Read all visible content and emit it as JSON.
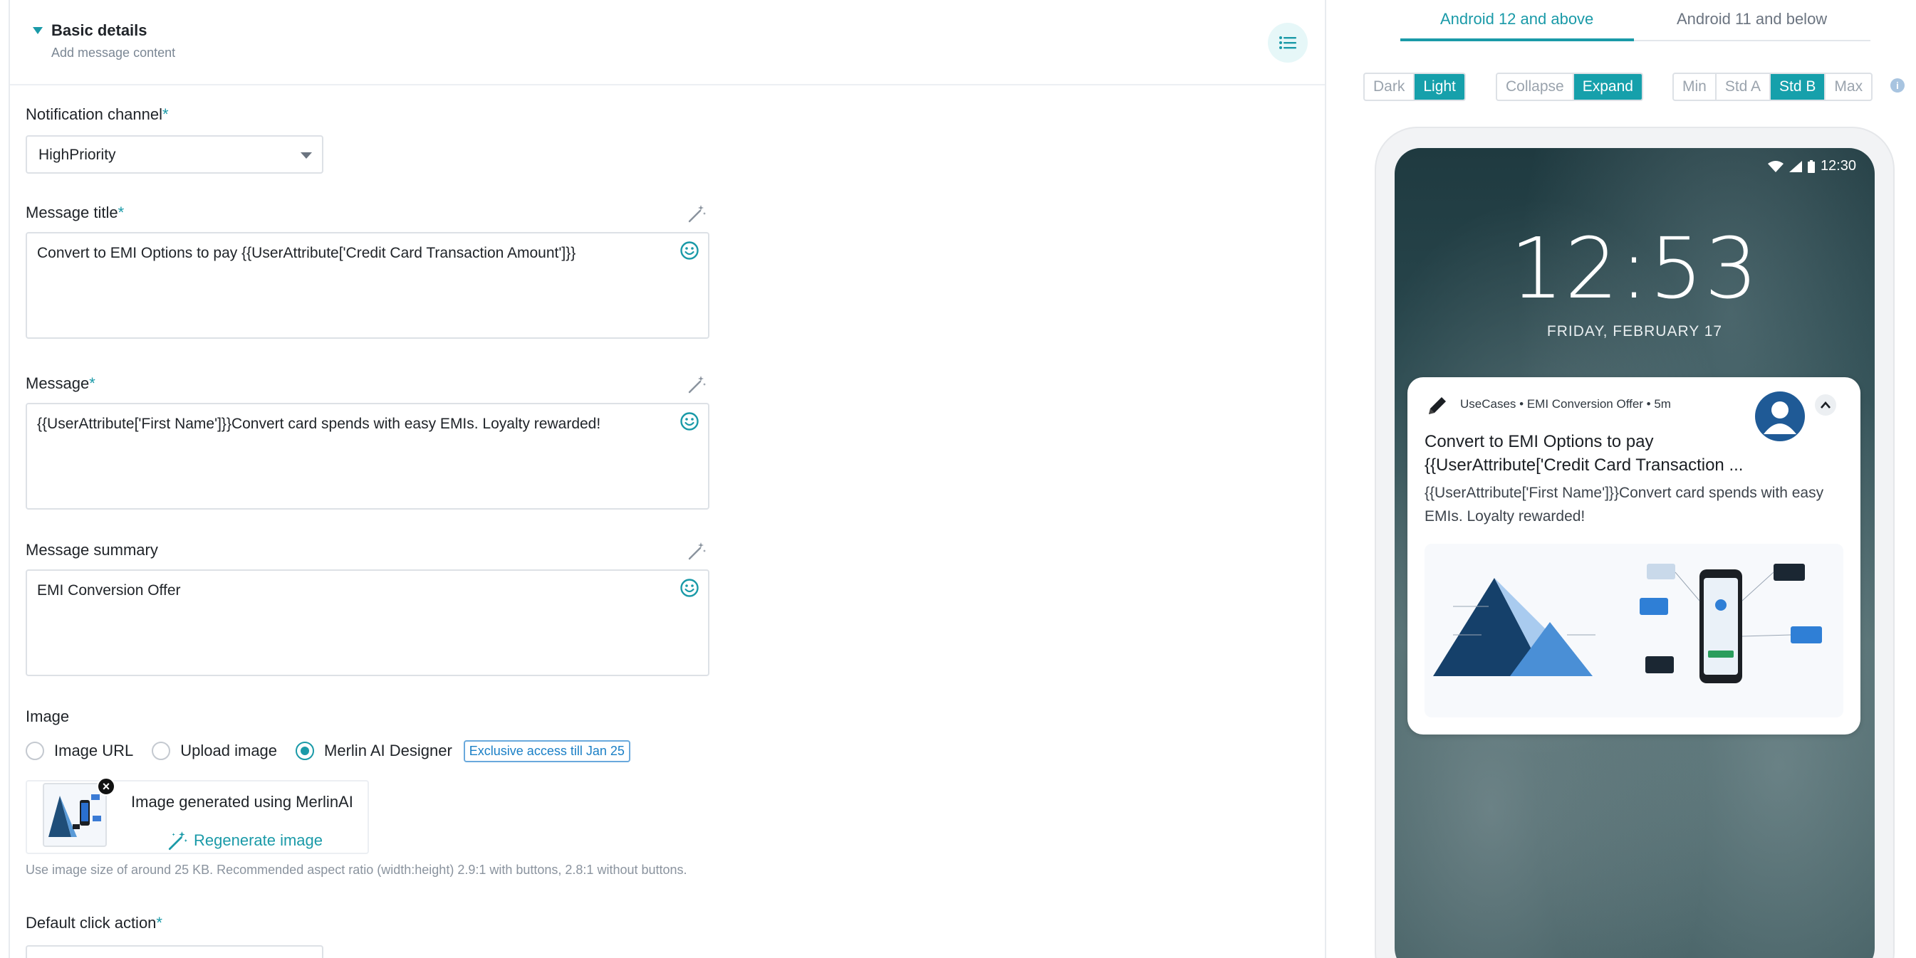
{
  "form": {
    "section_title": "Basic details",
    "section_subtitle": "Add message content",
    "required_mark": "*",
    "notification_channel": {
      "label": "Notification channel",
      "value": "HighPriority"
    },
    "message_title": {
      "label": "Message title",
      "value": "Convert to EMI Options to pay {{UserAttribute['Credit Card Transaction Amount']}}"
    },
    "message": {
      "label": "Message",
      "value": "{{UserAttribute['First Name']}}Convert card spends with easy EMIs. Loyalty rewarded!"
    },
    "message_summary": {
      "label": "Message summary",
      "value": "EMI Conversion Offer"
    },
    "image": {
      "label": "Image",
      "options": [
        "Image URL",
        "Upload image",
        "Merlin AI Designer"
      ],
      "selected": "Merlin AI Designer",
      "badge": "Exclusive access till Jan 25",
      "generated_text": "Image generated using MerlinAI",
      "regenerate_label": "Regenerate image",
      "close_glyph": "×",
      "hint": "Use image size of around 25 KB. Recommended aspect ratio (width:height) 2.9:1 with buttons, 2.8:1 without buttons."
    },
    "default_click_action": {
      "label": "Default click action"
    }
  },
  "preview": {
    "tabs": [
      "Android 12 and above",
      "Android 11 and below"
    ],
    "active_tab": "Android 12 and above",
    "theme_toggle": [
      "Dark",
      "Light"
    ],
    "theme_selected": "Light",
    "expand_toggle": [
      "Collapse",
      "Expand"
    ],
    "expand_selected": "Expand",
    "size_toggle": [
      "Min",
      "Std A",
      "Std B",
      "Max"
    ],
    "size_selected": "Std B",
    "info_glyph": "i",
    "status_time": "12:30",
    "clock": "12:53",
    "date": "FRIDAY, FEBRUARY 17",
    "notification": {
      "meta": "UseCases • EMI Conversion Offer • 5m",
      "title_line1": "Convert to EMI Options to pay",
      "title_line2": "{{UserAttribute['Credit Card Transaction ...",
      "body": "{{UserAttribute['First Name']}}Convert card spends with easy EMIs. Loyalty rewarded!"
    }
  },
  "colors": {
    "accent": "#1a9aa8",
    "badge_blue": "#1a7fc6"
  }
}
